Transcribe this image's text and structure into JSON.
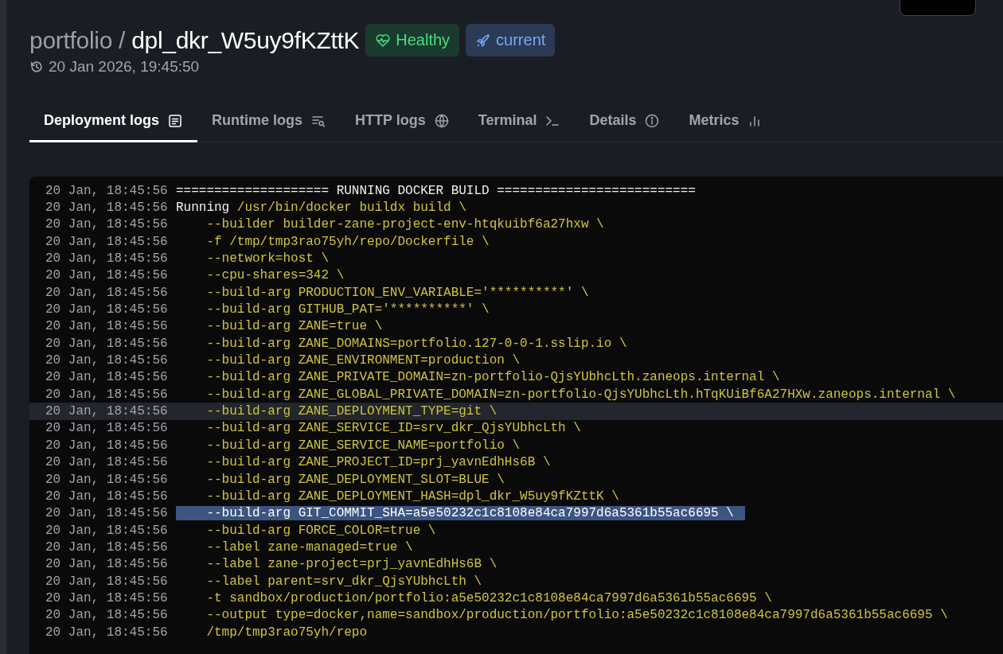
{
  "header": {
    "project": "portfolio /",
    "deployment": "dpl_dkr_W5uy9fKZttK",
    "badges": [
      {
        "kind": "health",
        "label": "Healthy"
      },
      {
        "kind": "current",
        "label": "current"
      }
    ],
    "date": "20 Jan 2026, 19:45:50"
  },
  "tabs": [
    {
      "label": "Deployment logs",
      "kind": "doc",
      "selected": true
    },
    {
      "label": "Runtime logs",
      "kind": "search-lines",
      "selected": false
    },
    {
      "label": "HTTP logs",
      "kind": "globe",
      "selected": false
    },
    {
      "label": "Terminal",
      "kind": "terminal",
      "selected": false
    },
    {
      "label": "Details",
      "kind": "info",
      "selected": false
    },
    {
      "label": "Metrics",
      "kind": "bars",
      "selected": false
    }
  ],
  "logs": [
    {
      "time": "20 Jan, 18:45:56",
      "hovered": false,
      "selected": false,
      "segments": [
        {
          "kind": "plain",
          "text": "==================== RUNNING DOCKER BUILD =========================="
        }
      ]
    },
    {
      "time": "20 Jan, 18:45:56",
      "hovered": false,
      "selected": false,
      "segments": [
        {
          "kind": "plain",
          "text": "Running "
        },
        {
          "kind": "arg",
          "text": "/usr/bin/docker buildx build \\"
        }
      ]
    },
    {
      "time": "20 Jan, 18:45:56",
      "hovered": false,
      "selected": false,
      "segments": [
        {
          "kind": "arg",
          "text": "    --builder builder-zane-project-env-htqkuibf6a27hxw \\"
        }
      ]
    },
    {
      "time": "20 Jan, 18:45:56",
      "hovered": false,
      "selected": false,
      "segments": [
        {
          "kind": "arg",
          "text": "    -f /tmp/tmp3rao75yh/repo/Dockerfile \\"
        }
      ]
    },
    {
      "time": "20 Jan, 18:45:56",
      "hovered": false,
      "selected": false,
      "segments": [
        {
          "kind": "arg",
          "text": "    --network=host \\"
        }
      ]
    },
    {
      "time": "20 Jan, 18:45:56",
      "hovered": false,
      "selected": false,
      "segments": [
        {
          "kind": "arg",
          "text": "    --cpu-shares=342 \\"
        }
      ]
    },
    {
      "time": "20 Jan, 18:45:56",
      "hovered": false,
      "selected": false,
      "segments": [
        {
          "kind": "arg",
          "text": "    --build-arg PRODUCTION_ENV_VARIABLE='**********' \\"
        }
      ]
    },
    {
      "time": "20 Jan, 18:45:56",
      "hovered": false,
      "selected": false,
      "segments": [
        {
          "kind": "arg",
          "text": "    --build-arg GITHUB_PAT='**********' \\"
        }
      ]
    },
    {
      "time": "20 Jan, 18:45:56",
      "hovered": false,
      "selected": false,
      "segments": [
        {
          "kind": "arg",
          "text": "    --build-arg ZANE=true \\"
        }
      ]
    },
    {
      "time": "20 Jan, 18:45:56",
      "hovered": false,
      "selected": false,
      "segments": [
        {
          "kind": "arg",
          "text": "    --build-arg ZANE_DOMAINS=portfolio.127-0-0-1.sslip.io \\"
        }
      ]
    },
    {
      "time": "20 Jan, 18:45:56",
      "hovered": false,
      "selected": false,
      "segments": [
        {
          "kind": "arg",
          "text": "    --build-arg ZANE_ENVIRONMENT=production \\"
        }
      ]
    },
    {
      "time": "20 Jan, 18:45:56",
      "hovered": false,
      "selected": false,
      "segments": [
        {
          "kind": "arg",
          "text": "    --build-arg ZANE_PRIVATE_DOMAIN=zn-portfolio-QjsYUbhcLth.zaneops.internal \\"
        }
      ]
    },
    {
      "time": "20 Jan, 18:45:56",
      "hovered": false,
      "selected": false,
      "segments": [
        {
          "kind": "arg",
          "text": "    --build-arg ZANE_GLOBAL_PRIVATE_DOMAIN=zn-portfolio-QjsYUbhcLth.hTqKUiBf6A27HXw.zaneops.internal \\"
        }
      ]
    },
    {
      "time": "20 Jan, 18:45:56",
      "hovered": true,
      "selected": false,
      "segments": [
        {
          "kind": "arg",
          "text": "    --build-arg ZANE_DEPLOYMENT_TYPE=git \\"
        }
      ]
    },
    {
      "time": "20 Jan, 18:45:56",
      "hovered": false,
      "selected": false,
      "segments": [
        {
          "kind": "arg",
          "text": "    --build-arg ZANE_SERVICE_ID=srv_dkr_QjsYUbhcLth \\"
        }
      ]
    },
    {
      "time": "20 Jan, 18:45:56",
      "hovered": false,
      "selected": false,
      "segments": [
        {
          "kind": "arg",
          "text": "    --build-arg ZANE_SERVICE_NAME=portfolio \\"
        }
      ]
    },
    {
      "time": "20 Jan, 18:45:56",
      "hovered": false,
      "selected": false,
      "segments": [
        {
          "kind": "arg",
          "text": "    --build-arg ZANE_PROJECT_ID=prj_yavnEdhHs6B \\"
        }
      ]
    },
    {
      "time": "20 Jan, 18:45:56",
      "hovered": false,
      "selected": false,
      "segments": [
        {
          "kind": "arg",
          "text": "    --build-arg ZANE_DEPLOYMENT_SLOT=BLUE \\"
        }
      ]
    },
    {
      "time": "20 Jan, 18:45:56",
      "hovered": false,
      "selected": false,
      "segments": [
        {
          "kind": "arg",
          "text": "    --build-arg ZANE_DEPLOYMENT_HASH=dpl_dkr_W5uy9fKZttK \\"
        }
      ]
    },
    {
      "time": "20 Jan, 18:45:56",
      "hovered": false,
      "selected": true,
      "segments": [
        {
          "kind": "arg",
          "text": "    --build-arg GIT_COMMIT_SHA=a5e50232c1c8108e84ca7997d6a5361b55ac6695 \\"
        }
      ]
    },
    {
      "time": "20 Jan, 18:45:56",
      "hovered": false,
      "selected": false,
      "segments": [
        {
          "kind": "arg",
          "text": "    --build-arg FORCE_COLOR=true \\"
        }
      ]
    },
    {
      "time": "20 Jan, 18:45:56",
      "hovered": false,
      "selected": false,
      "segments": [
        {
          "kind": "arg",
          "text": "    --label zane-managed=true \\"
        }
      ]
    },
    {
      "time": "20 Jan, 18:45:56",
      "hovered": false,
      "selected": false,
      "segments": [
        {
          "kind": "arg",
          "text": "    --label zane-project=prj_yavnEdhHs6B \\"
        }
      ]
    },
    {
      "time": "20 Jan, 18:45:56",
      "hovered": false,
      "selected": false,
      "segments": [
        {
          "kind": "arg",
          "text": "    --label parent=srv_dkr_QjsYUbhcLth \\"
        }
      ]
    },
    {
      "time": "20 Jan, 18:45:56",
      "hovered": false,
      "selected": false,
      "segments": [
        {
          "kind": "arg",
          "text": "    -t sandbox/production/portfolio:a5e50232c1c8108e84ca7997d6a5361b55ac6695 \\"
        }
      ]
    },
    {
      "time": "20 Jan, 18:45:56",
      "hovered": false,
      "selected": false,
      "segments": [
        {
          "kind": "arg",
          "text": "    --output type=docker,name=sandbox/production/portfolio:a5e50232c1c8108e84ca7997d6a5361b55ac6695 \\"
        }
      ]
    },
    {
      "time": "20 Jan, 18:45:56",
      "hovered": false,
      "selected": false,
      "segments": [
        {
          "kind": "arg",
          "text": "    /tmp/tmp3rao75yh/repo"
        }
      ]
    }
  ]
}
